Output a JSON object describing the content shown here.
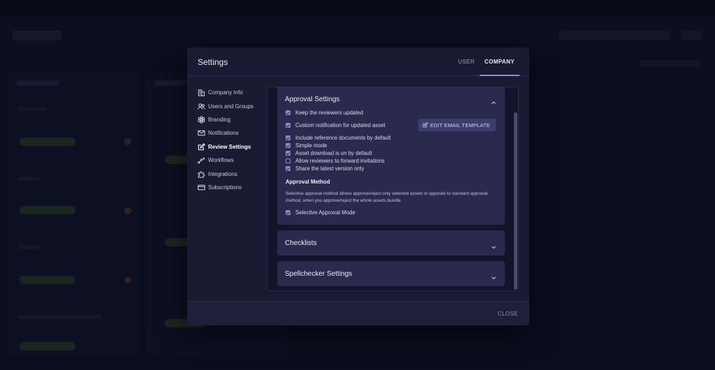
{
  "modal": {
    "title": "Settings",
    "tabs": [
      {
        "label": "USER",
        "active": false
      },
      {
        "label": "COMPANY",
        "active": true
      }
    ],
    "close_label": "CLOSE"
  },
  "sidebar": {
    "items": [
      {
        "label": "Company Info",
        "icon": "building-icon"
      },
      {
        "label": "Users and Groups",
        "icon": "users-icon"
      },
      {
        "label": "Branding",
        "icon": "palette-icon"
      },
      {
        "label": "Notifications",
        "icon": "envelope-icon"
      },
      {
        "label": "Review Settings",
        "icon": "edit-icon",
        "active": true
      },
      {
        "label": "Workflows",
        "icon": "workflow-icon"
      },
      {
        "label": "Integrations",
        "icon": "puzzle-icon"
      },
      {
        "label": "Subscriptions",
        "icon": "card-icon"
      }
    ]
  },
  "approval": {
    "title": "Approval Settings",
    "options": [
      {
        "label": "Keep the reviewers updated",
        "checked": true
      },
      {
        "label": "Custom notification for updated asset",
        "checked": true
      },
      {
        "label": "Include reference documents by default",
        "checked": true
      },
      {
        "label": "Simple mode",
        "checked": true
      },
      {
        "label": "Asset download is on by default",
        "checked": true
      },
      {
        "label": "Allow reviewers to forward invitations",
        "checked": false
      },
      {
        "label": "Share the latest version only",
        "checked": true
      }
    ],
    "edit_email_label": "EDIT EMAIL TEMPLATE",
    "method_heading": "Approval Method",
    "method_description": "Selective approval method allows approve/reject only selected assets in opposite to standard approval method, when you approve/reject the whole assets bundle",
    "selective_label": "Selective Approval Mode",
    "selective_checked": true
  },
  "checklists": {
    "title": "Checklists"
  },
  "spellchecker": {
    "title": "Spellchecker Settings"
  },
  "colors": {
    "modal_bg": "#1a1b33",
    "panel_bg": "#292a4d",
    "accent": "#8a8dc6"
  }
}
